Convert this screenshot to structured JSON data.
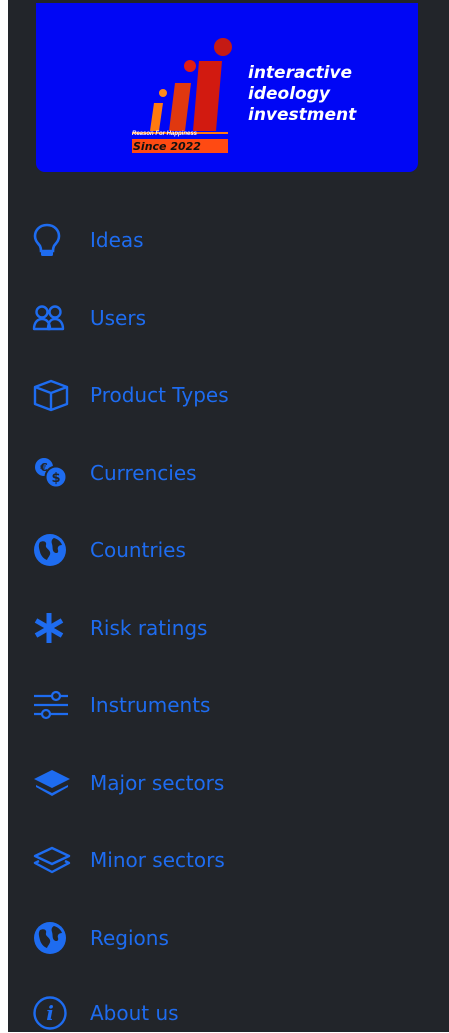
{
  "logo": {
    "line1": "interactive",
    "line2": "ideology",
    "line3": "investment",
    "tagline": "Reason For Happiness",
    "since": "Since 2022",
    "icon": "iii-logo-mark",
    "colors": {
      "background": "#0006f5",
      "primary_bar": "#d21a10",
      "accent_bar": "#ff7a10",
      "dot": "#c51a14"
    }
  },
  "menu": {
    "items": [
      {
        "label": "Ideas",
        "icon": "lightbulb-icon"
      },
      {
        "label": "Users",
        "icon": "users-icon"
      },
      {
        "label": "Product Types",
        "icon": "cube-icon"
      },
      {
        "label": "Currencies",
        "icon": "currency-exchange-icon"
      },
      {
        "label": "Countries",
        "icon": "globe-icon"
      },
      {
        "label": "Risk ratings",
        "icon": "asterisk-icon"
      },
      {
        "label": "Instruments",
        "icon": "sliders-icon"
      },
      {
        "label": "Major sectors",
        "icon": "layers-filled-icon"
      },
      {
        "label": "Minor sectors",
        "icon": "layers-outline-icon"
      },
      {
        "label": "Regions",
        "icon": "globe-icon"
      },
      {
        "label": "About us",
        "icon": "info-circle-icon"
      }
    ]
  },
  "colors": {
    "sidebar_bg": "#22252a",
    "link": "#1e6cf0"
  }
}
